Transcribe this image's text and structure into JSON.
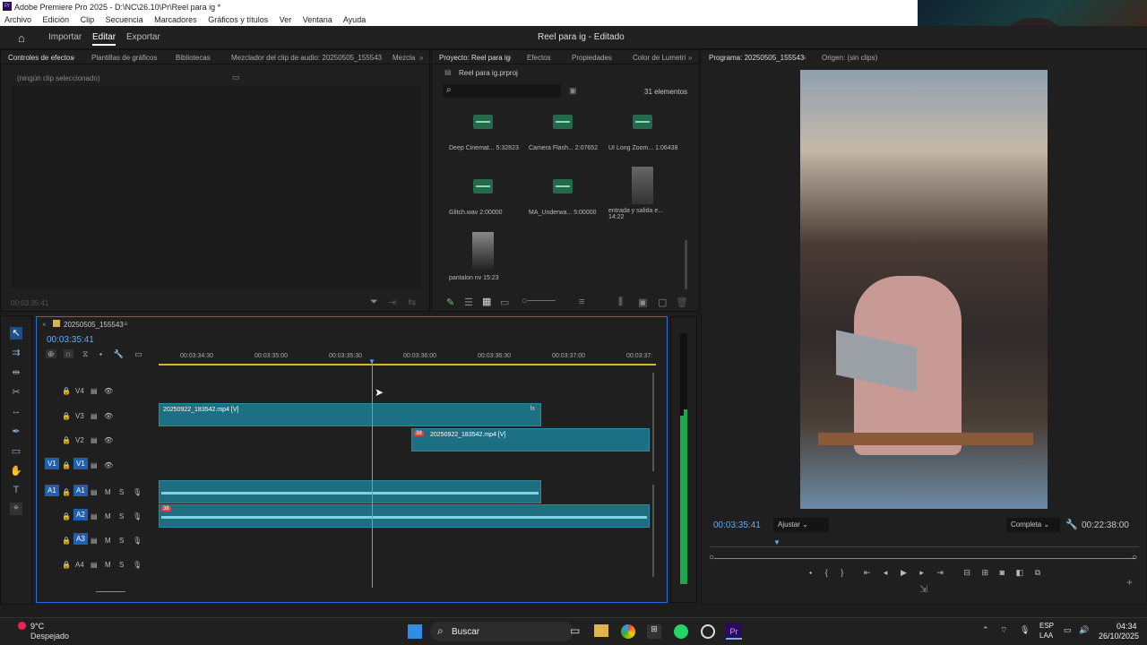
{
  "titlebar": {
    "title": "Adobe Premiere Pro 2025 - D:\\NC\\26.10\\Pr\\Reel para ig *"
  },
  "menu": [
    "Archivo",
    "Edición",
    "Clip",
    "Secuencia",
    "Marcadores",
    "Gráficos y títulos",
    "Ver",
    "Ventana",
    "Ayuda"
  ],
  "nav": {
    "importar": "Importar",
    "editar": "Editar",
    "exportar": "Exportar",
    "doc_title": "Reel para ig - Editado"
  },
  "effects_panel": {
    "tabs": [
      "Controles de efectos",
      "Plantillas de gráficos",
      "Bibliotecas",
      "Mezclador del clip de audio: 20250505_155543",
      "Mezcla"
    ],
    "empty": "(ningún clip seleccionado)",
    "time": "00:03:35:41"
  },
  "project": {
    "tabs": [
      "Proyecto: Reel para ig",
      "Efectos",
      "Propiedades",
      "Color de Lumetri"
    ],
    "file": "Reel para ig.prproj",
    "count": "31 elementos",
    "items": [
      {
        "name": "Deep Cinemat...",
        "dur": "5:32823",
        "kind": "audio"
      },
      {
        "name": "Camera Flash...",
        "dur": "2:07652",
        "kind": "audio"
      },
      {
        "name": "UI Long Zoom...",
        "dur": "1:06438",
        "kind": "audio"
      },
      {
        "name": "Glitch.wav",
        "dur": "2:00000",
        "kind": "audio"
      },
      {
        "name": "MA_Underwa...",
        "dur": "5:00000",
        "kind": "audio"
      },
      {
        "name": "entrada y salida e...",
        "dur": "14:22",
        "kind": "video"
      },
      {
        "name": "pantalon nv",
        "dur": "15:23",
        "kind": "video"
      }
    ]
  },
  "monitor": {
    "tabs": [
      "Programa: 20250505_155543",
      "Origen: (sin clips)"
    ],
    "timecode": "00:03:35:41",
    "fit": "Ajustar",
    "quality": "Completa",
    "duration": "00:22:38:00"
  },
  "timeline": {
    "seq": "20250505_155543",
    "timecode": "00:03:35:41",
    "ruler": [
      "00:03:34:30",
      "00:03:35:00",
      "00:03:35:30",
      "00:03:36:00",
      "00:03:36:30",
      "00:03:37:00",
      "00:03:37:"
    ],
    "tracks": [
      "V4",
      "V3",
      "V2",
      "V1",
      "A1",
      "A2",
      "A3",
      "A4"
    ],
    "clip1": "20250922_183542.mp4 [V]",
    "clip2": "20250922_183542.mp4 [V]",
    "badge": "38"
  },
  "taskbar": {
    "temp": "9°C",
    "weather": "Despejado",
    "search": "Buscar",
    "lang1": "ESP",
    "lang2": "LAA",
    "time": "04:34",
    "date": "26/10/2025"
  }
}
